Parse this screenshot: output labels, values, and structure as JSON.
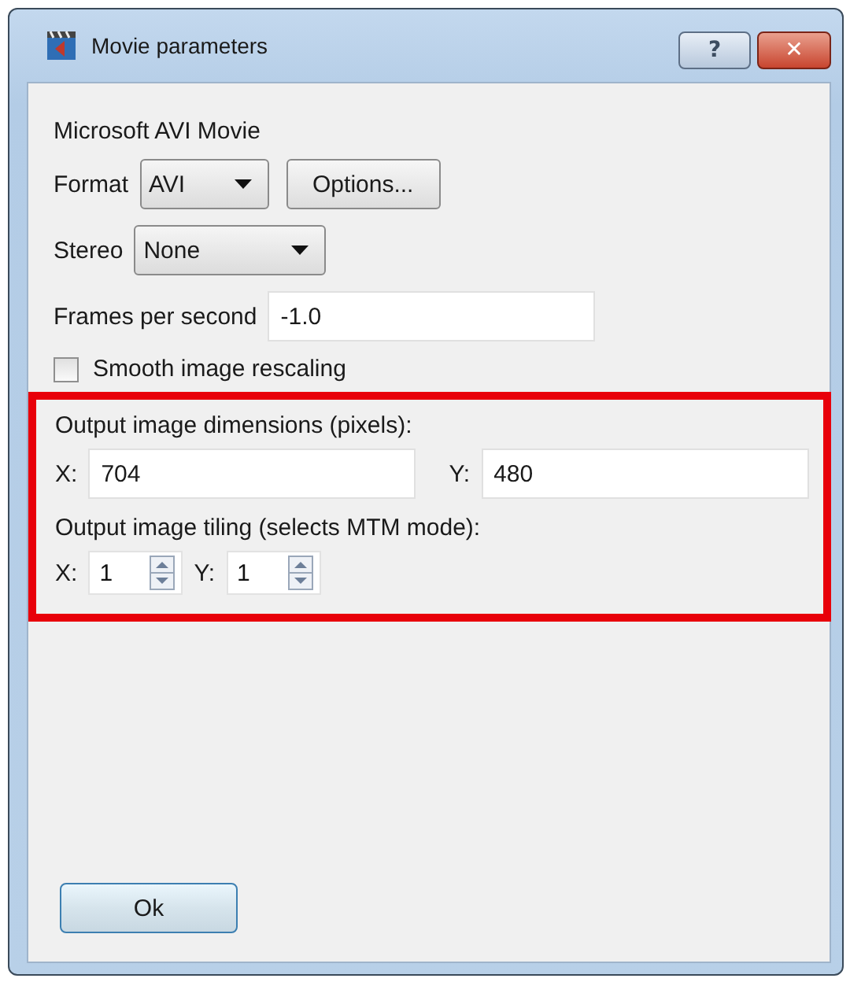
{
  "window": {
    "title": "Movie parameters",
    "help_button": "?",
    "close_button": "✕"
  },
  "description": "Microsoft AVI Movie",
  "format": {
    "label": "Format",
    "value": "AVI",
    "options_button": "Options..."
  },
  "stereo": {
    "label": "Stereo",
    "value": "None"
  },
  "fps": {
    "label": "Frames per second",
    "value": "-1.0"
  },
  "smooth": {
    "label": "Smooth image rescaling",
    "checked": false
  },
  "dimensions": {
    "label": "Output image dimensions (pixels):",
    "x_label": "X:",
    "x_value": "704",
    "y_label": "Y:",
    "y_value": "480"
  },
  "tiling": {
    "label": "Output image tiling (selects MTM mode):",
    "x_label": "X:",
    "x_value": "1",
    "y_label": "Y:",
    "y_value": "1"
  },
  "ok_button": "Ok"
}
